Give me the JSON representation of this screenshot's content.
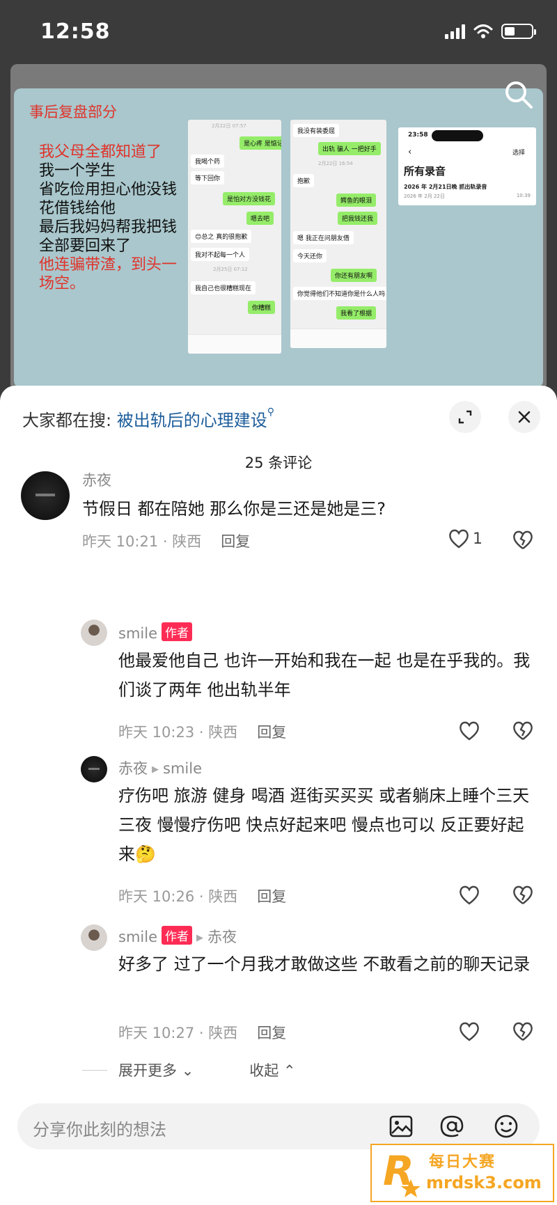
{
  "status_bar": {
    "time": "12:58"
  },
  "poster": {
    "title": "事后复盘部分",
    "lines": [
      {
        "text": "我父母全都知道了",
        "red": true
      },
      {
        "text": "我一个学生",
        "red": false
      },
      {
        "text": "省吃俭用担心他没钱",
        "red": false
      },
      {
        "text": "花借钱给他",
        "red": false
      },
      {
        "text": "最后我妈妈帮我把钱",
        "red": false
      },
      {
        "text": "全部要回来了",
        "red": false
      },
      {
        "text": "他连骗带渣，到头一",
        "red": true
      },
      {
        "text": "场空。",
        "red": true
      }
    ],
    "chat1": [
      "2月22日 07:57",
      "是心疼 是惦记。",
      "我喝个药",
      "等下回你",
      "是怕对方没钱花",
      "嗯去吧",
      "😊总之 真的很抱歉",
      "我对不起每一个人",
      "2月25日 07:12",
      "我自己也很糟糕现在",
      "你糟糕"
    ],
    "chat2": [
      "我没有装委屈",
      "出轨 骗人 一把好手",
      "2月22日 16:54",
      "抱歉",
      "鳄鱼的眼泪",
      "把我钱还我",
      "嗯 我正在问朋友借",
      "今天还你",
      "你还有朋友啊",
      "你觉得他们不知道你是什么人吗",
      "我看了根据"
    ],
    "recording": {
      "time": "23:58",
      "select": "选择",
      "title": "所有录音",
      "item": "2026 年 2月21日晚 抓出轨录音",
      "date": "2026 年 2月 22日",
      "duration": "10:39"
    }
  },
  "sheet": {
    "search_prefix": "大家都在搜:",
    "search_query": "被出轨后的心理建设",
    "comment_count": "25 条评论",
    "author_badge": "作者",
    "reply_label": "回复",
    "comments": [
      {
        "user": "赤夜",
        "text": "节假日 都在陪她 那么你是三还是她是三?",
        "meta": "昨天 10:21 · 陕西",
        "likes": "1"
      },
      {
        "user": "smile",
        "text": "他最爱他自己 也许一开始和我在一起 也是在乎我的。我们谈了两年 他出轨半年",
        "meta": "昨天 10:23 · 陕西"
      },
      {
        "user": "赤夜",
        "reply_to": "smile",
        "text": "疗伤吧  旅游 健身 喝酒 逛街买买买 或者躺床上睡个三天三夜   慢慢疗伤吧      快点好起来吧 慢点也可以 反正要好起来🤔",
        "meta": "昨天 10:26 · 陕西"
      },
      {
        "user": "smile",
        "reply_to": "赤夜",
        "text": "好多了 过了一个月我才敢做这些 不敢看之前的聊天记录",
        "meta": "昨天 10:27 · 陕西"
      }
    ],
    "expand_more": "展开更多",
    "collapse": "收起",
    "input_placeholder": "分享你此刻的想法"
  },
  "watermark": {
    "title": "每日大赛",
    "url": "mrdsk3.com"
  },
  "colors": {
    "accent": "#fe2c55",
    "search_link": "#1d5d9b",
    "wechat_green": "#95ec69",
    "poster_bg": "#a9c7cc",
    "watermark": "#f5a623"
  }
}
